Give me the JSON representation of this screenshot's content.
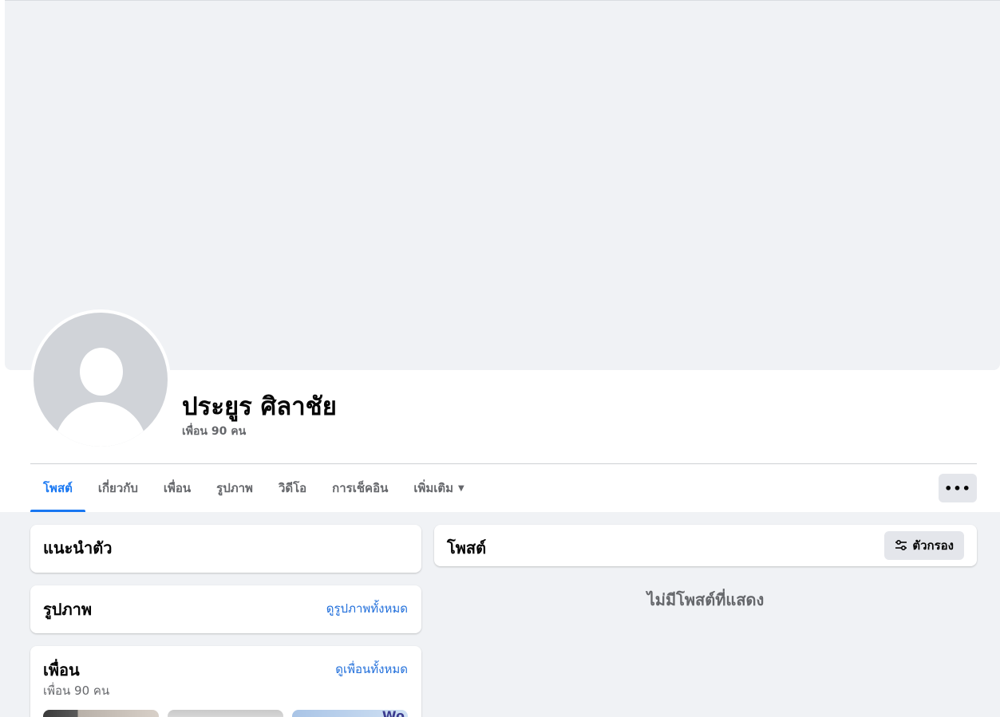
{
  "profile": {
    "name": "ประยูร ศิลาชัย",
    "friend_count": "เพื่อน 90 คน"
  },
  "tabs": [
    {
      "label": "โพสต์",
      "active": true
    },
    {
      "label": "เกี่ยวกับ"
    },
    {
      "label": "เพื่อน"
    },
    {
      "label": "รูปภาพ"
    },
    {
      "label": "วิดีโอ"
    },
    {
      "label": "การเช็คอิน"
    },
    {
      "label": "เพิ่มเติม"
    }
  ],
  "more_menu_icon": "ellipsis-icon",
  "intro": {
    "title": "แนะนำตัว"
  },
  "photos": {
    "title": "รูปภาพ",
    "see_all": "ดูรูปภาพทั้งหมด"
  },
  "friends": {
    "title": "เพื่อน",
    "see_all": "ดูเพื่อนทั้งหมด",
    "count": "เพื่อน 90 คน",
    "thumb_text": "Wo"
  },
  "posts": {
    "title": "โพสต์",
    "filter_label": "ตัวกรอง",
    "empty_message": "ไม่มีโพสต์ที่แสดง"
  },
  "colors": {
    "accent": "#1877f2",
    "link": "#216fdb",
    "background": "#f0f2f5",
    "secondary_text": "#65676b"
  }
}
